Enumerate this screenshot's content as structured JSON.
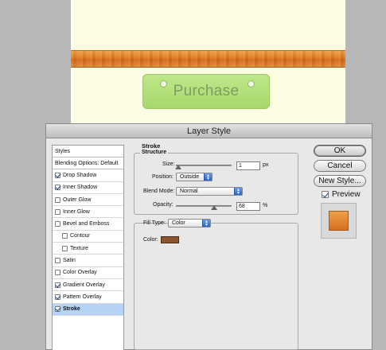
{
  "canvas": {
    "purchase_label": "Purchase",
    "colors": {
      "background": "#fdfde4",
      "wood": "#e0791e",
      "button": "#b2de78"
    }
  },
  "dialog": {
    "title": "Layer Style",
    "styles_panel": {
      "header": "Styles",
      "blending_options": "Blending Options: Default",
      "items": [
        {
          "label": "Drop Shadow",
          "checked": true
        },
        {
          "label": "Inner Shadow",
          "checked": true
        },
        {
          "label": "Outer Glow",
          "checked": false
        },
        {
          "label": "Inner Glow",
          "checked": false
        },
        {
          "label": "Bevel and Emboss",
          "checked": false
        },
        {
          "label": "Contour",
          "checked": false
        },
        {
          "label": "Texture",
          "checked": false
        },
        {
          "label": "Satin",
          "checked": false
        },
        {
          "label": "Color Overlay",
          "checked": false
        },
        {
          "label": "Gradient Overlay",
          "checked": true
        },
        {
          "label": "Pattern Overlay",
          "checked": true
        },
        {
          "label": "Stroke",
          "checked": true,
          "selected": true
        }
      ]
    },
    "stroke": {
      "section_title": "Stroke",
      "structure_title": "Structure",
      "size_label": "Size:",
      "size_value": "1",
      "size_unit": "px",
      "position_label": "Position:",
      "position_value": "Outside",
      "blend_mode_label": "Blend Mode:",
      "blend_mode_value": "Normal",
      "opacity_label": "Opacity:",
      "opacity_value": "68",
      "opacity_unit": "%",
      "fill_type_label": "Fill Type:",
      "fill_type_value": "Color",
      "color_label": "Color:",
      "stroke_color": "#8a5530"
    },
    "buttons": {
      "ok": "OK",
      "cancel": "Cancel",
      "new_style": "New Style...",
      "preview": "Preview",
      "preview_checked": true
    }
  }
}
